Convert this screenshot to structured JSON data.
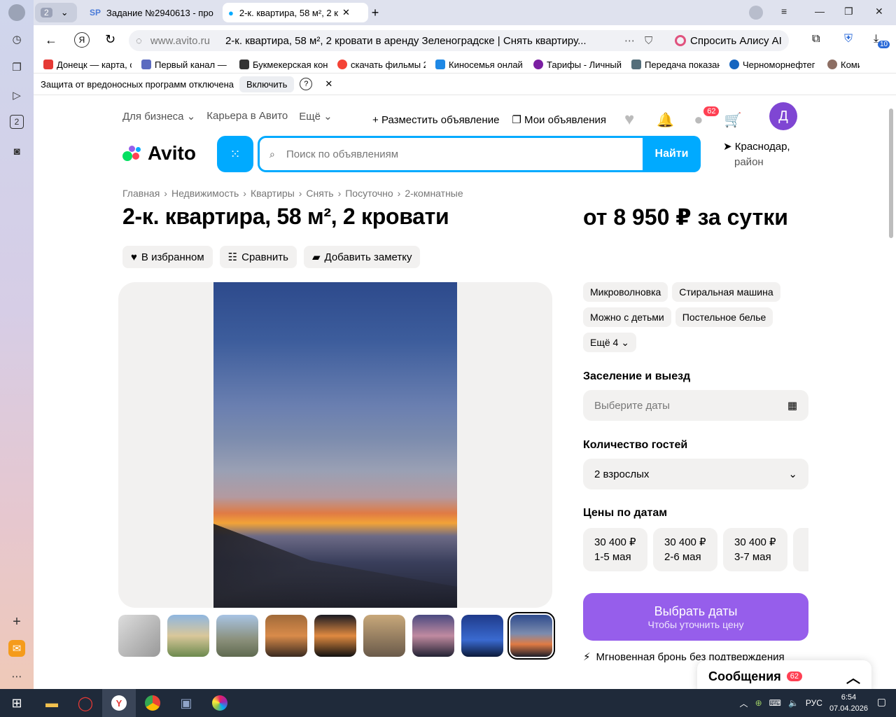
{
  "browser": {
    "tab_count_badge": "2",
    "tabs": [
      {
        "label": "Задание №2940613 - про"
      },
      {
        "label": "2-к. квартира, 58 м², 2 к"
      }
    ],
    "url_domain": "www.avito.ru",
    "page_title_in_bar": "2-к. квартира, 58 м², 2 кровати в аренду Зеленоградске | Снять квартиру...",
    "alice_label": "Спросить Алису AI",
    "downloads_badge": "10",
    "rail_tab_number": "2",
    "bookmarks": [
      {
        "label": "Донецк — карта, с",
        "color": "#e53935"
      },
      {
        "label": "Первый канал — с",
        "color": "#5c6bc0"
      },
      {
        "label": "Букмекерская кон",
        "color": "#333333"
      },
      {
        "label": "скачать фильмы 2",
        "color": "#f44336"
      },
      {
        "label": "Киносемья онлай",
        "color": "#1e88e5"
      },
      {
        "label": "Тарифы - Личный",
        "color": "#7b1fa2"
      },
      {
        "label": "Передача показан",
        "color": "#546e7a"
      },
      {
        "label": "Черноморнефтег",
        "color": "#1565c0"
      },
      {
        "label": "Коми",
        "color": "#8d6e63"
      }
    ],
    "protection_text": "Защита от вредоносных программ отключена",
    "protection_button": "Включить"
  },
  "site": {
    "nav_business": "Для бизнеса",
    "nav_career": "Карьера в Авито",
    "nav_more": "Ещё",
    "post_ad": "Разместить объявление",
    "my_ads": "Мои объявления",
    "messages_badge": "62",
    "user_initial": "Д",
    "logo_text": "Avito",
    "search_placeholder": "Поиск по объявлениям",
    "search_button": "Найти",
    "location_line1": "Краснодар,",
    "location_line2": "район",
    "accent": "#00aaff",
    "cta_color": "#965eeb"
  },
  "listing": {
    "breadcrumbs": [
      "Главная",
      "Недвижимость",
      "Квартиры",
      "Снять",
      "Посуточно",
      "2-комнатные"
    ],
    "title": "2-к. квартира, 58 м², 2 кровати",
    "price": "от 8 950 ₽ за сутки",
    "actions": {
      "favorite": "В избранном",
      "compare": "Сравнить",
      "note": "Добавить заметку"
    },
    "amenities": [
      "Микроволновка",
      "Стиральная машина",
      "Можно с детьми",
      "Постельное белье"
    ],
    "amenities_more": "Ещё 4",
    "checkin_label": "Заселение и выезд",
    "dates_placeholder": "Выберите даты",
    "guests_label": "Количество гостей",
    "guests_value": "2 взрослых",
    "prices_label": "Цены по датам",
    "date_prices": [
      {
        "price": "30 400 ₽",
        "dates": "1-5 мая"
      },
      {
        "price": "30 400 ₽",
        "dates": "2-6 мая"
      },
      {
        "price": "30 400 ₽",
        "dates": "3-7 мая"
      }
    ],
    "cta_title": "Выбрать даты",
    "cta_subtitle": "Чтобы уточнить цену",
    "instant_booking": "Мгновенная бронь без подтверждения",
    "messages_panel": "Сообщения",
    "messages_panel_badge": "62"
  },
  "taskbar": {
    "language": "РУС",
    "time": "6:54",
    "date": "07.04.2026"
  }
}
